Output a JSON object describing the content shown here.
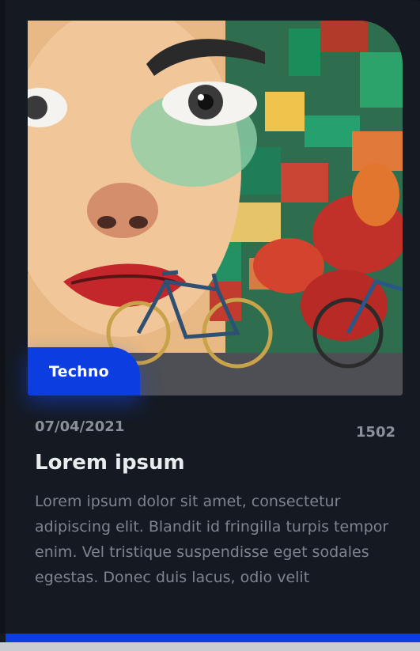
{
  "card": {
    "image_name": "graffiti-mural-with-bicycles",
    "tag": "Techno",
    "date": "07/04/2021",
    "views": "1502",
    "title": "Lorem ipsum",
    "body": "Lorem ipsum dolor sit amet, consectetur adipiscing elit. Blandit id fringilla turpis tempor enim. Vel tristique suspendisse eget sodales egestas. Donec duis lacus, odio velit"
  },
  "progress": {
    "fraction": 1.0
  },
  "colors": {
    "background": "#0f1319",
    "card": "#151a22",
    "accent": "#0b3de0",
    "text_primary": "#e9ebee",
    "text_secondary": "#8a9099"
  }
}
